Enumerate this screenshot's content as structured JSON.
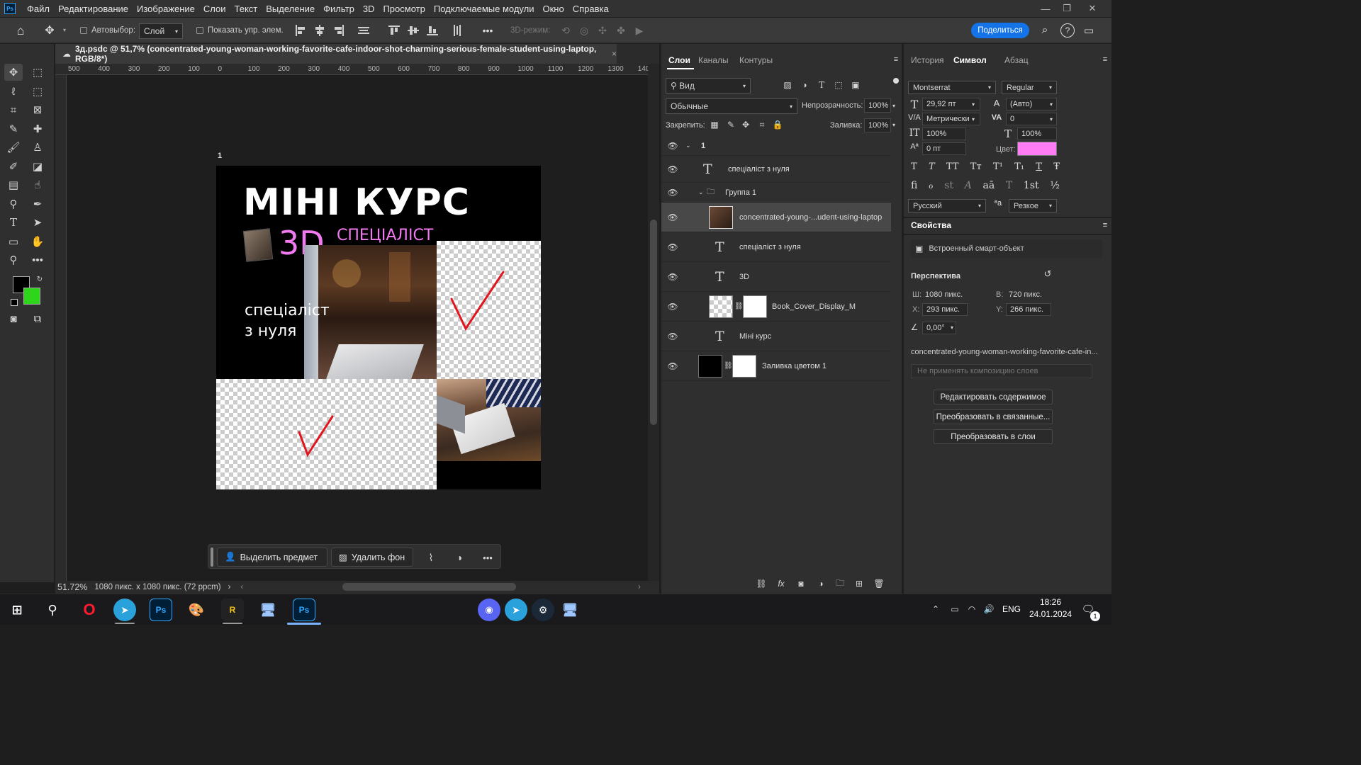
{
  "app": {
    "logo": "Ps"
  },
  "menu": [
    "Файл",
    "Редактирование",
    "Изображение",
    "Слои",
    "Текст",
    "Выделение",
    "Фильтр",
    "3D",
    "Просмотр",
    "Подключаемые модули",
    "Окно",
    "Справка"
  ],
  "options": {
    "autoselect_label": "Автовыбор:",
    "autoselect_value": "Слой",
    "show_controls_label": "Показать упр. элем.",
    "mode3d_label": "3D-режим:",
    "share_label": "Поделиться",
    "more": "•••"
  },
  "document": {
    "tab_title": "3д.psdc @ 51,7% (concentrated-young-woman-working-favorite-cafe-indoor-shot-charming-serious-female-student-using-laptop, RGB/8*)",
    "close": "×"
  },
  "ruler": {
    "marks": [
      "500",
      "400",
      "300",
      "200",
      "100",
      "0",
      "100",
      "200",
      "300",
      "400",
      "500",
      "600",
      "700",
      "800",
      "900",
      "1000",
      "1100",
      "1200",
      "1300",
      "140"
    ]
  },
  "canvas": {
    "artboard_label": "1",
    "headline": "МІНІ КУРС",
    "label_3d": "3D",
    "subtitle": "СПЕЦІАЛІСТ",
    "caption_line1": "спеціаліст",
    "caption_line2": "з нуля"
  },
  "context_bar": {
    "select_subject": "Выделить предмет",
    "remove_bg": "Удалить фон",
    "more": "•••"
  },
  "status": {
    "zoom": "51.72%",
    "doc_info": "1080 пикс. x 1080 пикс. (72 ppcm)",
    "arrow": "›",
    "left_arrow": "‹",
    "right_arrow": "›"
  },
  "layers_panel": {
    "tabs": [
      "Слои",
      "Каналы",
      "Контуры"
    ],
    "filter_label": "Вид",
    "blend_mode": "Обычные",
    "opacity_label": "Непрозрачность:",
    "opacity_value": "100%",
    "lock_label": "Закрепить:",
    "fill_label": "Заливка:",
    "fill_value": "100%",
    "rows": [
      {
        "name": "1",
        "type": "artboard"
      },
      {
        "name": "спеціаліст з нуля",
        "type": "text"
      },
      {
        "name": "Группа 1",
        "type": "group"
      },
      {
        "name": "concentrated-young-...udent-using-laptop",
        "type": "smart"
      },
      {
        "name": "спеціаліст з нуля",
        "type": "text"
      },
      {
        "name": "3D",
        "type": "text"
      },
      {
        "name": "Book_Cover_Display_M",
        "type": "smart-masked"
      },
      {
        "name": "Міні курс",
        "type": "text"
      },
      {
        "name": "Заливка цветом 1",
        "type": "fill"
      }
    ],
    "text_glyph": "T"
  },
  "right_panel": {
    "tabs": [
      "История",
      "Символ",
      "Абзац"
    ],
    "font_family": "Montserrat",
    "font_style": "Regular",
    "font_size": "29,92 пт",
    "leading": "(Авто)",
    "kerning": "Метрически",
    "tracking": "0",
    "vscale": "100%",
    "hscale": "100%",
    "baseline": "0 пт",
    "color_label": "Цвет:",
    "color": "#ff7cf4",
    "language": "Русский",
    "antialias": "Резкое",
    "glyphs_row1": [
      "T",
      "T",
      "TT",
      "Tт",
      "T¹",
      "T₁",
      "T",
      "Ŧ"
    ],
    "glyphs_row2": [
      "ﬁ",
      "ℴ",
      "st",
      "A",
      "aā",
      "T",
      "1st",
      "½"
    ],
    "glyph_icons": {
      "size": "T",
      "leading": "A",
      "kerning": "V/A",
      "tracking": "VA",
      "vscale": "IT",
      "hscale": "T",
      "baseline": "Aª",
      "aa": "ªa"
    }
  },
  "properties": {
    "title": "Свойства",
    "object_type": "Встроенный смарт-объект",
    "section": "Перспектива",
    "w_label": "Ш:",
    "w_value": "1080 пикс.",
    "h_label": "В:",
    "h_value": "720 пикс.",
    "x_label": "X:",
    "x_value": "293 пикс.",
    "y_label": "Y:",
    "y_value": "266 пикс.",
    "angle_value": "0,00°",
    "filename": "concentrated-young-woman-working-favorite-cafe-in...",
    "comp_placeholder": "Не применять композицию слоев",
    "btn_edit": "Редактировать содержимое",
    "btn_linked": "Преобразовать в связанные...",
    "btn_layers": "Преобразовать в слои"
  },
  "taskbar": {
    "apps": [
      "Ps",
      "R",
      "Ps"
    ],
    "lang": "ENG",
    "time": "18:26",
    "date": "24.01.2024",
    "notif": "1"
  }
}
